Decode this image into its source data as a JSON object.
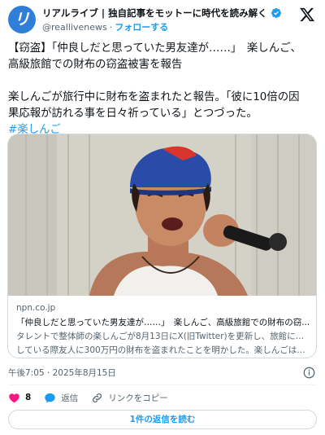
{
  "account": {
    "display_name": "リアルライブ | 独自記事をモットーに時代を読み解く",
    "handle": "@reallivenews",
    "separator": "·",
    "follow_label": "フォローする",
    "avatar_letter": "リ",
    "brand_color": "#2f7ed8"
  },
  "post": {
    "lines": [
      "【窃盗】「仲良しだと思っていた男友達が……」　楽しんご、",
      "高級旅館での財布の窃盗被害を報告",
      "楽しんごが旅行中に財布を盗まれたと報告。「彼に10倍の因",
      "果応報が訪れる事を日々祈っている」とつづった。"
    ],
    "hashtag": "#楽しんご"
  },
  "card": {
    "domain": "npn.co.jp",
    "title": "「仲良しだと思っていた男友達が……」　楽しんご、高級旅館での財布の窃...",
    "desc_lines": [
      "タレントで整体師の楽しんごが8月13日にX(旧Twitter)を更新し、旅館に宿泊",
      "している際友人に300万円の財布を盗まれたことを明かした。楽しんごはX..."
    ]
  },
  "meta": {
    "timestamp": "午後7:05 · 2025年8月15日"
  },
  "actions": {
    "like_count": "8",
    "reply_label": "返信",
    "copy_link_label": "リンクをコピー"
  },
  "replies_button": "1件の返信を読む",
  "colors": {
    "accent": "#1d9bf0",
    "like": "#f91880",
    "secondary_text": "#536471",
    "border": "#cfd9de"
  },
  "icons": [
    "verified-badge-icon",
    "x-logo-icon",
    "info-icon",
    "heart-icon",
    "reply-bubble-icon",
    "link-icon"
  ]
}
